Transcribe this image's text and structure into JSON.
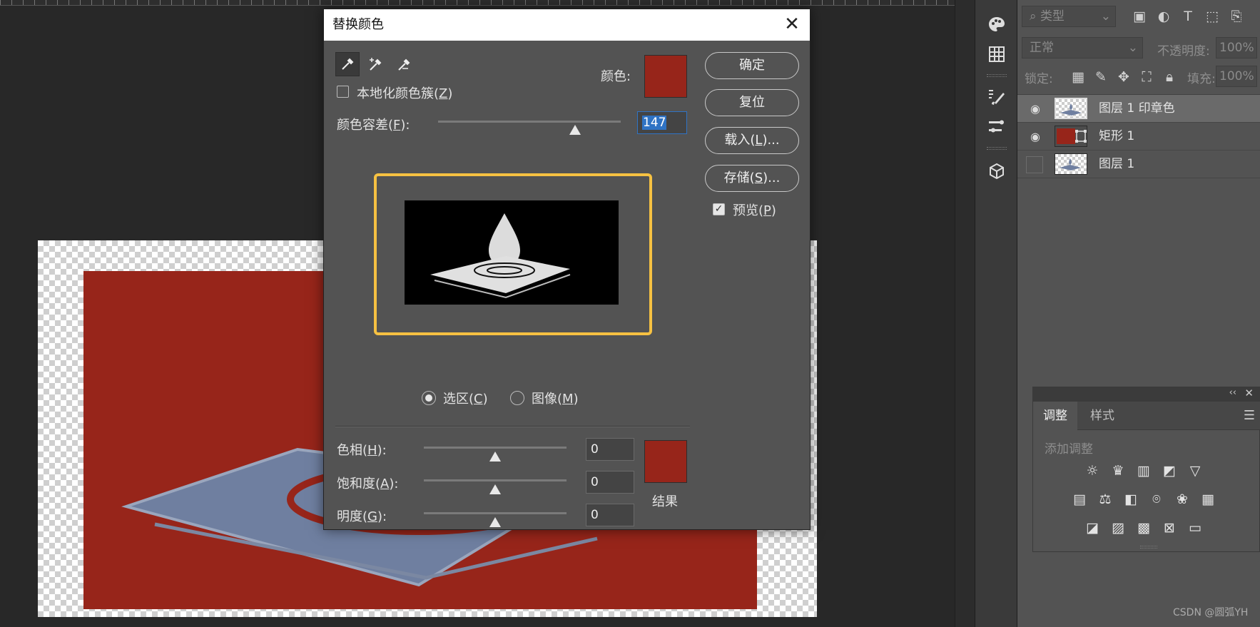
{
  "dialog": {
    "title": "替换颜色",
    "color_label": "颜色:",
    "localized_label": "本地化颜色簇(Z)",
    "tolerance_label": "颜色容差(F):",
    "tolerance_value": "147",
    "selection_label": "选区(C)",
    "image_label": "图像(M)",
    "hue_label": "色相(H):",
    "hue_value": "0",
    "saturation_label": "饱和度(A):",
    "saturation_value": "0",
    "lightness_label": "明度(G):",
    "lightness_value": "0",
    "result_label": "结果",
    "buttons": {
      "ok": "确定",
      "reset": "复位",
      "load": "载入(L)...",
      "save": "存储(S)..."
    },
    "preview_label": "预览(P)",
    "preview_checked": true,
    "localized_checked": false,
    "mode": "selection",
    "selected_color": "#97251a",
    "result_color": "#97251a",
    "eyedroppers": [
      "eyedropper-icon",
      "eyedropper-plus-icon",
      "eyedropper-minus-icon"
    ],
    "sliders": {
      "tolerance": 0.75,
      "hue": 0.5,
      "saturation": 0.5,
      "lightness": 0.5
    }
  },
  "layers_panel": {
    "filter_label": "类型",
    "blend_mode": "正常",
    "opacity_label": "不透明度:",
    "opacity_value": "100%",
    "lock_label": "锁定:",
    "fill_label": "填充:",
    "fill_value": "100%",
    "layers": [
      {
        "name": "图层 1 印章色",
        "visible": true,
        "selected": true
      },
      {
        "name": "矩形 1",
        "visible": true,
        "selected": false
      },
      {
        "name": "图层 1",
        "visible": false,
        "selected": false
      }
    ]
  },
  "adjustments_panel": {
    "tabs": [
      "调整",
      "样式"
    ],
    "active_tab": "调整",
    "add_adjustment_label": "添加调整"
  },
  "watermark": "CSDN @圆弧YH",
  "colors": {
    "accent_red": "#97251a",
    "highlight_frame": "#f6c142",
    "selection_blue": "#2f73c4"
  }
}
